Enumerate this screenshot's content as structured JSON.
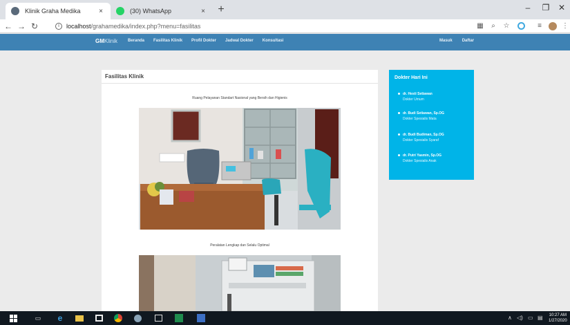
{
  "browser": {
    "tabs": [
      {
        "title": "Klinik Graha Medika",
        "active": true
      },
      {
        "title": "(30) WhatsApp",
        "active": false
      }
    ],
    "new_tab_glyph": "+",
    "close_glyph": "×",
    "address": {
      "host": "localhost",
      "path": "/grahamedika/index.php?menu=fasilitas"
    },
    "window_controls": [
      "–",
      "❐",
      "✕"
    ]
  },
  "site": {
    "brand_bold": "GM",
    "brand_light": "Klinik",
    "nav": [
      "Beranda",
      "Fasilitas Klinik",
      "Profil Dokter",
      "Jadwal Dokter",
      "Konsultasi"
    ],
    "nav_right": [
      "Masuk",
      "Daftar"
    ],
    "accent_color": "#3e82b4"
  },
  "main": {
    "heading": "Fasilitas Klinik",
    "facilities": [
      {
        "caption": "Ruang Pelayanan Standart Nasional yang Bersih dan Higienis"
      },
      {
        "caption": "Peralatan Lengkap dan Selalu Optimal"
      }
    ]
  },
  "sidebar": {
    "title": "Dokter Hari Ini",
    "color": "#00b4e8",
    "doctors": [
      {
        "name": "dr. Hesti Setiawan",
        "specialty": "Dokter Umum"
      },
      {
        "name": "dr. Budi Setiawan, Sp.OG",
        "specialty": "Dokter Spesialis Mata"
      },
      {
        "name": "dr. Budi Budiman, Sp.OG",
        "specialty": "Dokter Spesialis Syaraf"
      },
      {
        "name": "dr. Putri Yasmin, Sp.OG",
        "specialty": "Dokter Spesialis Anak"
      }
    ]
  },
  "taskbar": {
    "clock_time": "10:27 AM",
    "clock_date": "1/27/2020"
  }
}
